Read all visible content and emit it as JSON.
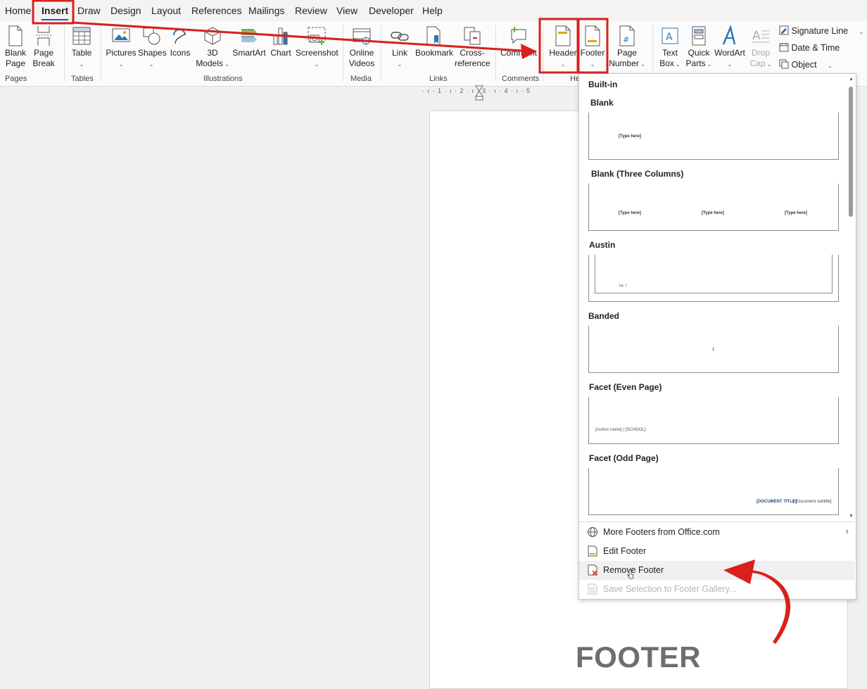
{
  "menu": {
    "tabs": [
      "Home",
      "Insert",
      "Draw",
      "Design",
      "Layout",
      "References",
      "Mailings",
      "Review",
      "View",
      "Developer",
      "Help"
    ],
    "active_tab": "Insert"
  },
  "ribbon": {
    "blank_page": [
      "Blank",
      "Page"
    ],
    "page_break": [
      "Page",
      "Break"
    ],
    "table": "Table",
    "pictures": "Pictures",
    "shapes": "Shapes",
    "icons": "Icons",
    "models_3d": [
      "3D",
      "Models"
    ],
    "smartart": "SmartArt",
    "chart": "Chart",
    "screenshot": "Screenshot",
    "online_videos": [
      "Online",
      "Videos"
    ],
    "link": "Link",
    "bookmark": "Bookmark",
    "cross_reference": [
      "Cross-",
      "reference"
    ],
    "comment": "Comment",
    "header": "Header",
    "footer": "Footer",
    "page_number": [
      "Page",
      "Number"
    ],
    "text_box": [
      "Text",
      "Box"
    ],
    "quick_parts": [
      "Quick",
      "Parts"
    ],
    "wordart": "WordArt",
    "drop_cap": [
      "Drop",
      "Cap"
    ],
    "signature_line": "Signature Line",
    "date_time": "Date & Time",
    "object": "Object",
    "groups": {
      "pages": "Pages",
      "tables": "Tables",
      "illustrations": "Illustrations",
      "media": "Media",
      "links": "Links",
      "comments": "Comments",
      "header_footer": "He"
    }
  },
  "ruler": {
    "marks": "· ı · 1 · ı · 2 · ı · 3 · ı · 4 · ı · 5"
  },
  "footer_gallery": {
    "section": "Built-in",
    "items": [
      {
        "name": "Blank",
        "placeholders": [
          "[Type here]"
        ]
      },
      {
        "name": "Blank (Three Columns)",
        "placeholders": [
          "[Type here]",
          "[Type here]",
          "[Type here]"
        ]
      },
      {
        "name": "Austin",
        "placeholders": [
          "pg. 1"
        ]
      },
      {
        "name": "Banded",
        "placeholders": [
          "1"
        ]
      },
      {
        "name": "Facet (Even Page)",
        "placeholders": [
          "[Author name] | [SCHOOL]"
        ]
      },
      {
        "name": "Facet (Odd Page)",
        "placeholders": [
          "[DOCUMENT TITLE]",
          "| [Document subtitle]"
        ]
      }
    ],
    "menu": {
      "more": "More Footers from Office.com",
      "edit": "Edit Footer",
      "remove": "Remove Footer",
      "save": "Save Selection to Footer Gallery..."
    }
  },
  "annotation": {
    "caption": "FOOTER",
    "highlight_color": "#d9201e"
  },
  "colors": {
    "accent": "#185abd",
    "annotation_red": "#d9201e"
  }
}
